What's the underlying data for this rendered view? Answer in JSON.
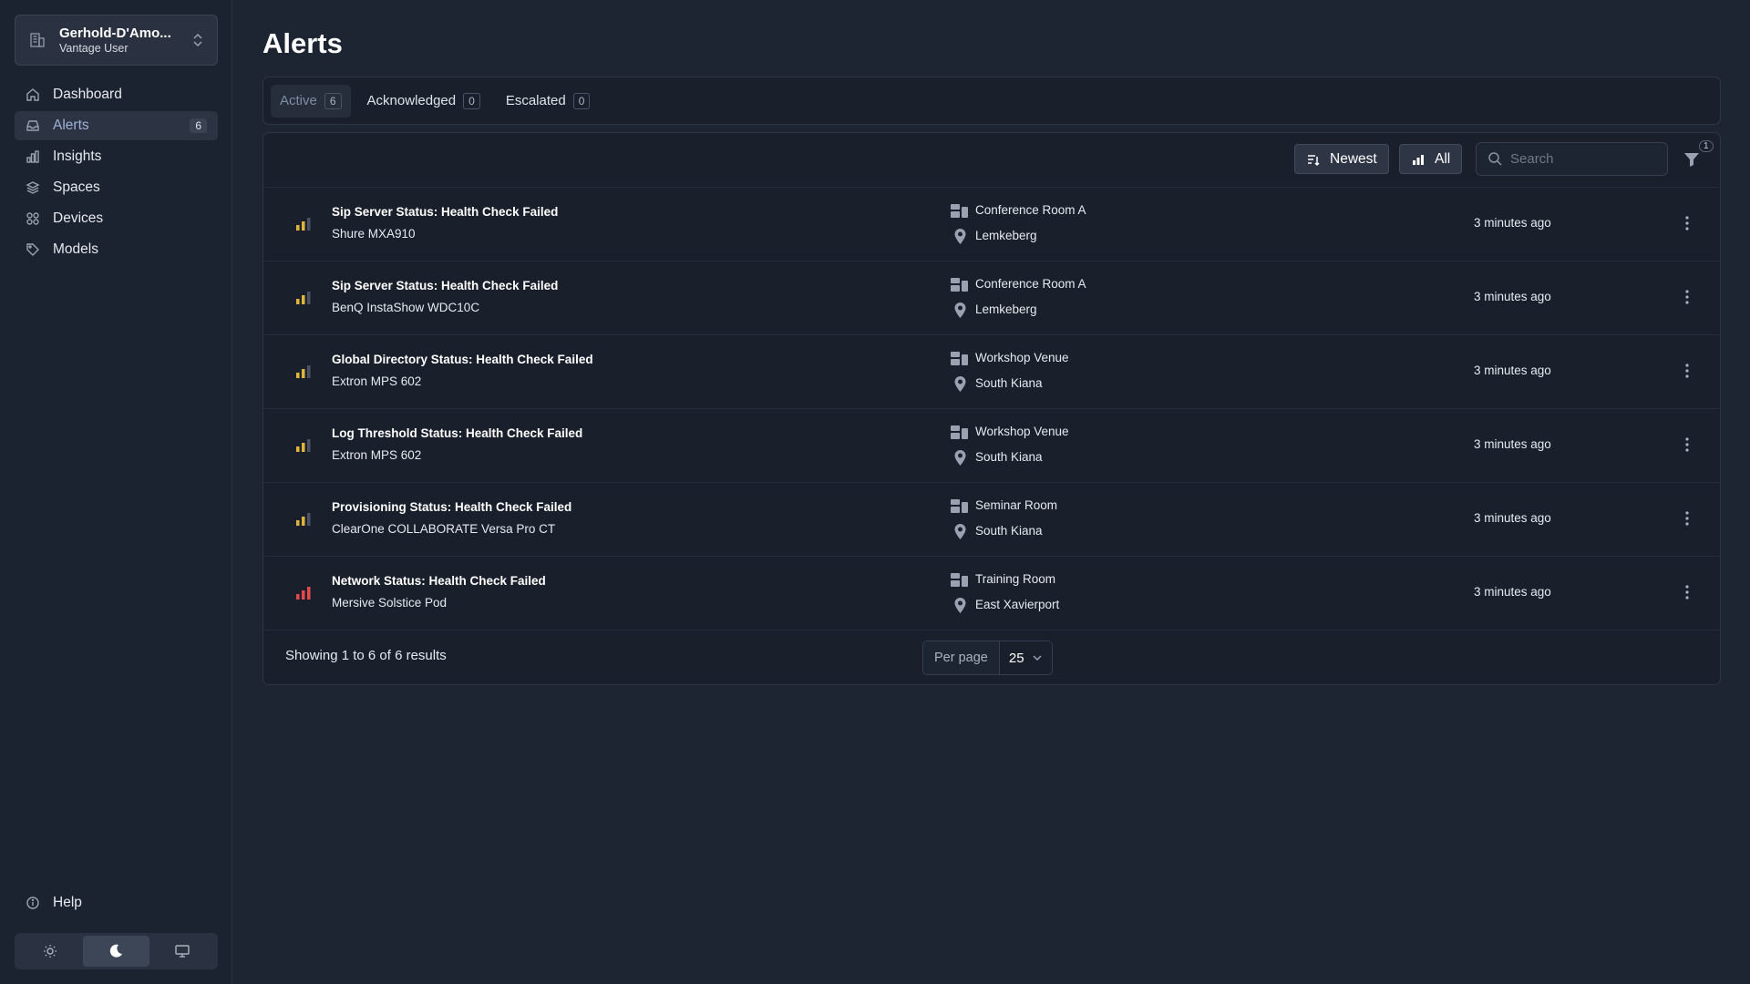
{
  "org": {
    "name": "Gerhold-D'Amo...",
    "role": "Vantage User"
  },
  "nav": [
    {
      "label": "Dashboard",
      "icon": "home-icon"
    },
    {
      "label": "Alerts",
      "icon": "inbox-icon",
      "badge": "6",
      "active": true
    },
    {
      "label": "Insights",
      "icon": "bar-chart-icon"
    },
    {
      "label": "Spaces",
      "icon": "layers-icon"
    },
    {
      "label": "Devices",
      "icon": "grid-icon"
    },
    {
      "label": "Models",
      "icon": "tag-icon"
    }
  ],
  "help": {
    "label": "Help"
  },
  "page": {
    "title": "Alerts"
  },
  "tabs": [
    {
      "label": "Active",
      "count": "6"
    },
    {
      "label": "Acknowledged",
      "count": "0"
    },
    {
      "label": "Escalated",
      "count": "0"
    }
  ],
  "toolbar": {
    "sort_label": "Newest",
    "severity_label": "All",
    "search_placeholder": "Search",
    "filter_count": "1"
  },
  "colors": {
    "warning": "#e0b53d",
    "critical": "#e5484d",
    "inactive_bar": "#4a5365"
  },
  "alerts": [
    {
      "title": "Sip Server Status: Health Check Failed",
      "device": "Shure MXA910",
      "room": "Conference Room A",
      "location": "Lemkeberg",
      "time": "3 minutes ago",
      "severity": "warning"
    },
    {
      "title": "Sip Server Status: Health Check Failed",
      "device": "BenQ InstaShow WDC10C",
      "room": "Conference Room A",
      "location": "Lemkeberg",
      "time": "3 minutes ago",
      "severity": "warning"
    },
    {
      "title": "Global Directory Status: Health Check Failed",
      "device": "Extron MPS 602",
      "room": "Workshop Venue",
      "location": "South Kiana",
      "time": "3 minutes ago",
      "severity": "warning"
    },
    {
      "title": "Log Threshold Status: Health Check Failed",
      "device": "Extron MPS 602",
      "room": "Workshop Venue",
      "location": "South Kiana",
      "time": "3 minutes ago",
      "severity": "warning"
    },
    {
      "title": "Provisioning Status: Health Check Failed",
      "device": "ClearOne COLLABORATE Versa Pro CT",
      "room": "Seminar Room",
      "location": "South Kiana",
      "time": "3 minutes ago",
      "severity": "warning"
    },
    {
      "title": "Network Status: Health Check Failed",
      "device": "Mersive Solstice Pod",
      "room": "Training Room",
      "location": "East Xavierport",
      "time": "3 minutes ago",
      "severity": "critical"
    }
  ],
  "footer": {
    "results": "Showing 1 to 6 of 6 results",
    "per_page_label": "Per page",
    "per_page_value": "25"
  }
}
